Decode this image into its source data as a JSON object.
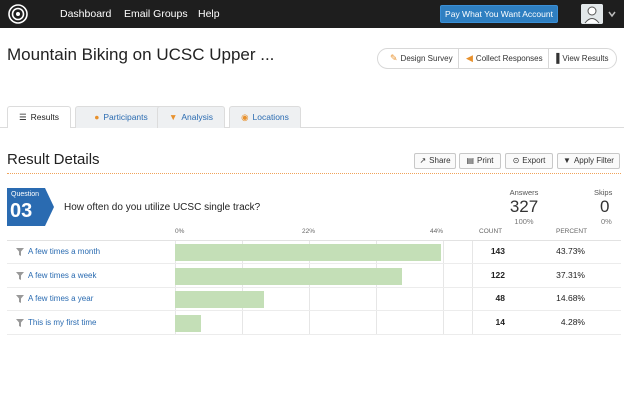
{
  "nav": {
    "items": [
      "Dashboard",
      "Email Groups",
      "Help"
    ],
    "pay_button": "Pay What You Want Account"
  },
  "survey": {
    "title": "Mountain Biking on UCSC Upper ...",
    "actions": {
      "design": "Design Survey",
      "collect": "Collect Responses",
      "view": "View Results"
    }
  },
  "tabs": [
    {
      "label": "Results",
      "active": true
    },
    {
      "label": "Participants",
      "active": false
    },
    {
      "label": "Analysis",
      "active": false
    },
    {
      "label": "Locations",
      "active": false
    }
  ],
  "result_details": {
    "title": "Result Details",
    "buttons": {
      "share": "Share",
      "print": "Print",
      "export": "Export",
      "filter": "Apply Filter"
    }
  },
  "question": {
    "badge_label": "Question",
    "number": "03",
    "text": "How often do you utilize UCSC single track?",
    "answers_label": "Answers",
    "answers_count": "327",
    "answers_pct": "100%",
    "skips_label": "Skips",
    "skips_count": "0",
    "skips_pct": "0%"
  },
  "table": {
    "axis_ticks": [
      "0%",
      "22%",
      "44%"
    ],
    "col_count": "COUNT",
    "col_percent": "PERCENT",
    "axis_max": 44
  },
  "chart_data": {
    "type": "bar",
    "categories": [
      "A few times a month",
      "A few times a week",
      "A few times a year",
      "This is my first time"
    ],
    "counts": [
      143,
      122,
      48,
      14
    ],
    "percent_labels": [
      "43.73%",
      "37.31%",
      "14.68%",
      "4.28%"
    ],
    "values": [
      43.73,
      37.31,
      14.68,
      4.28
    ],
    "xlim": [
      0,
      44
    ]
  },
  "colors": {
    "accent": "#2a6bb1",
    "bar": "#c4dfb7",
    "pay_button": "#2f7fc1"
  }
}
